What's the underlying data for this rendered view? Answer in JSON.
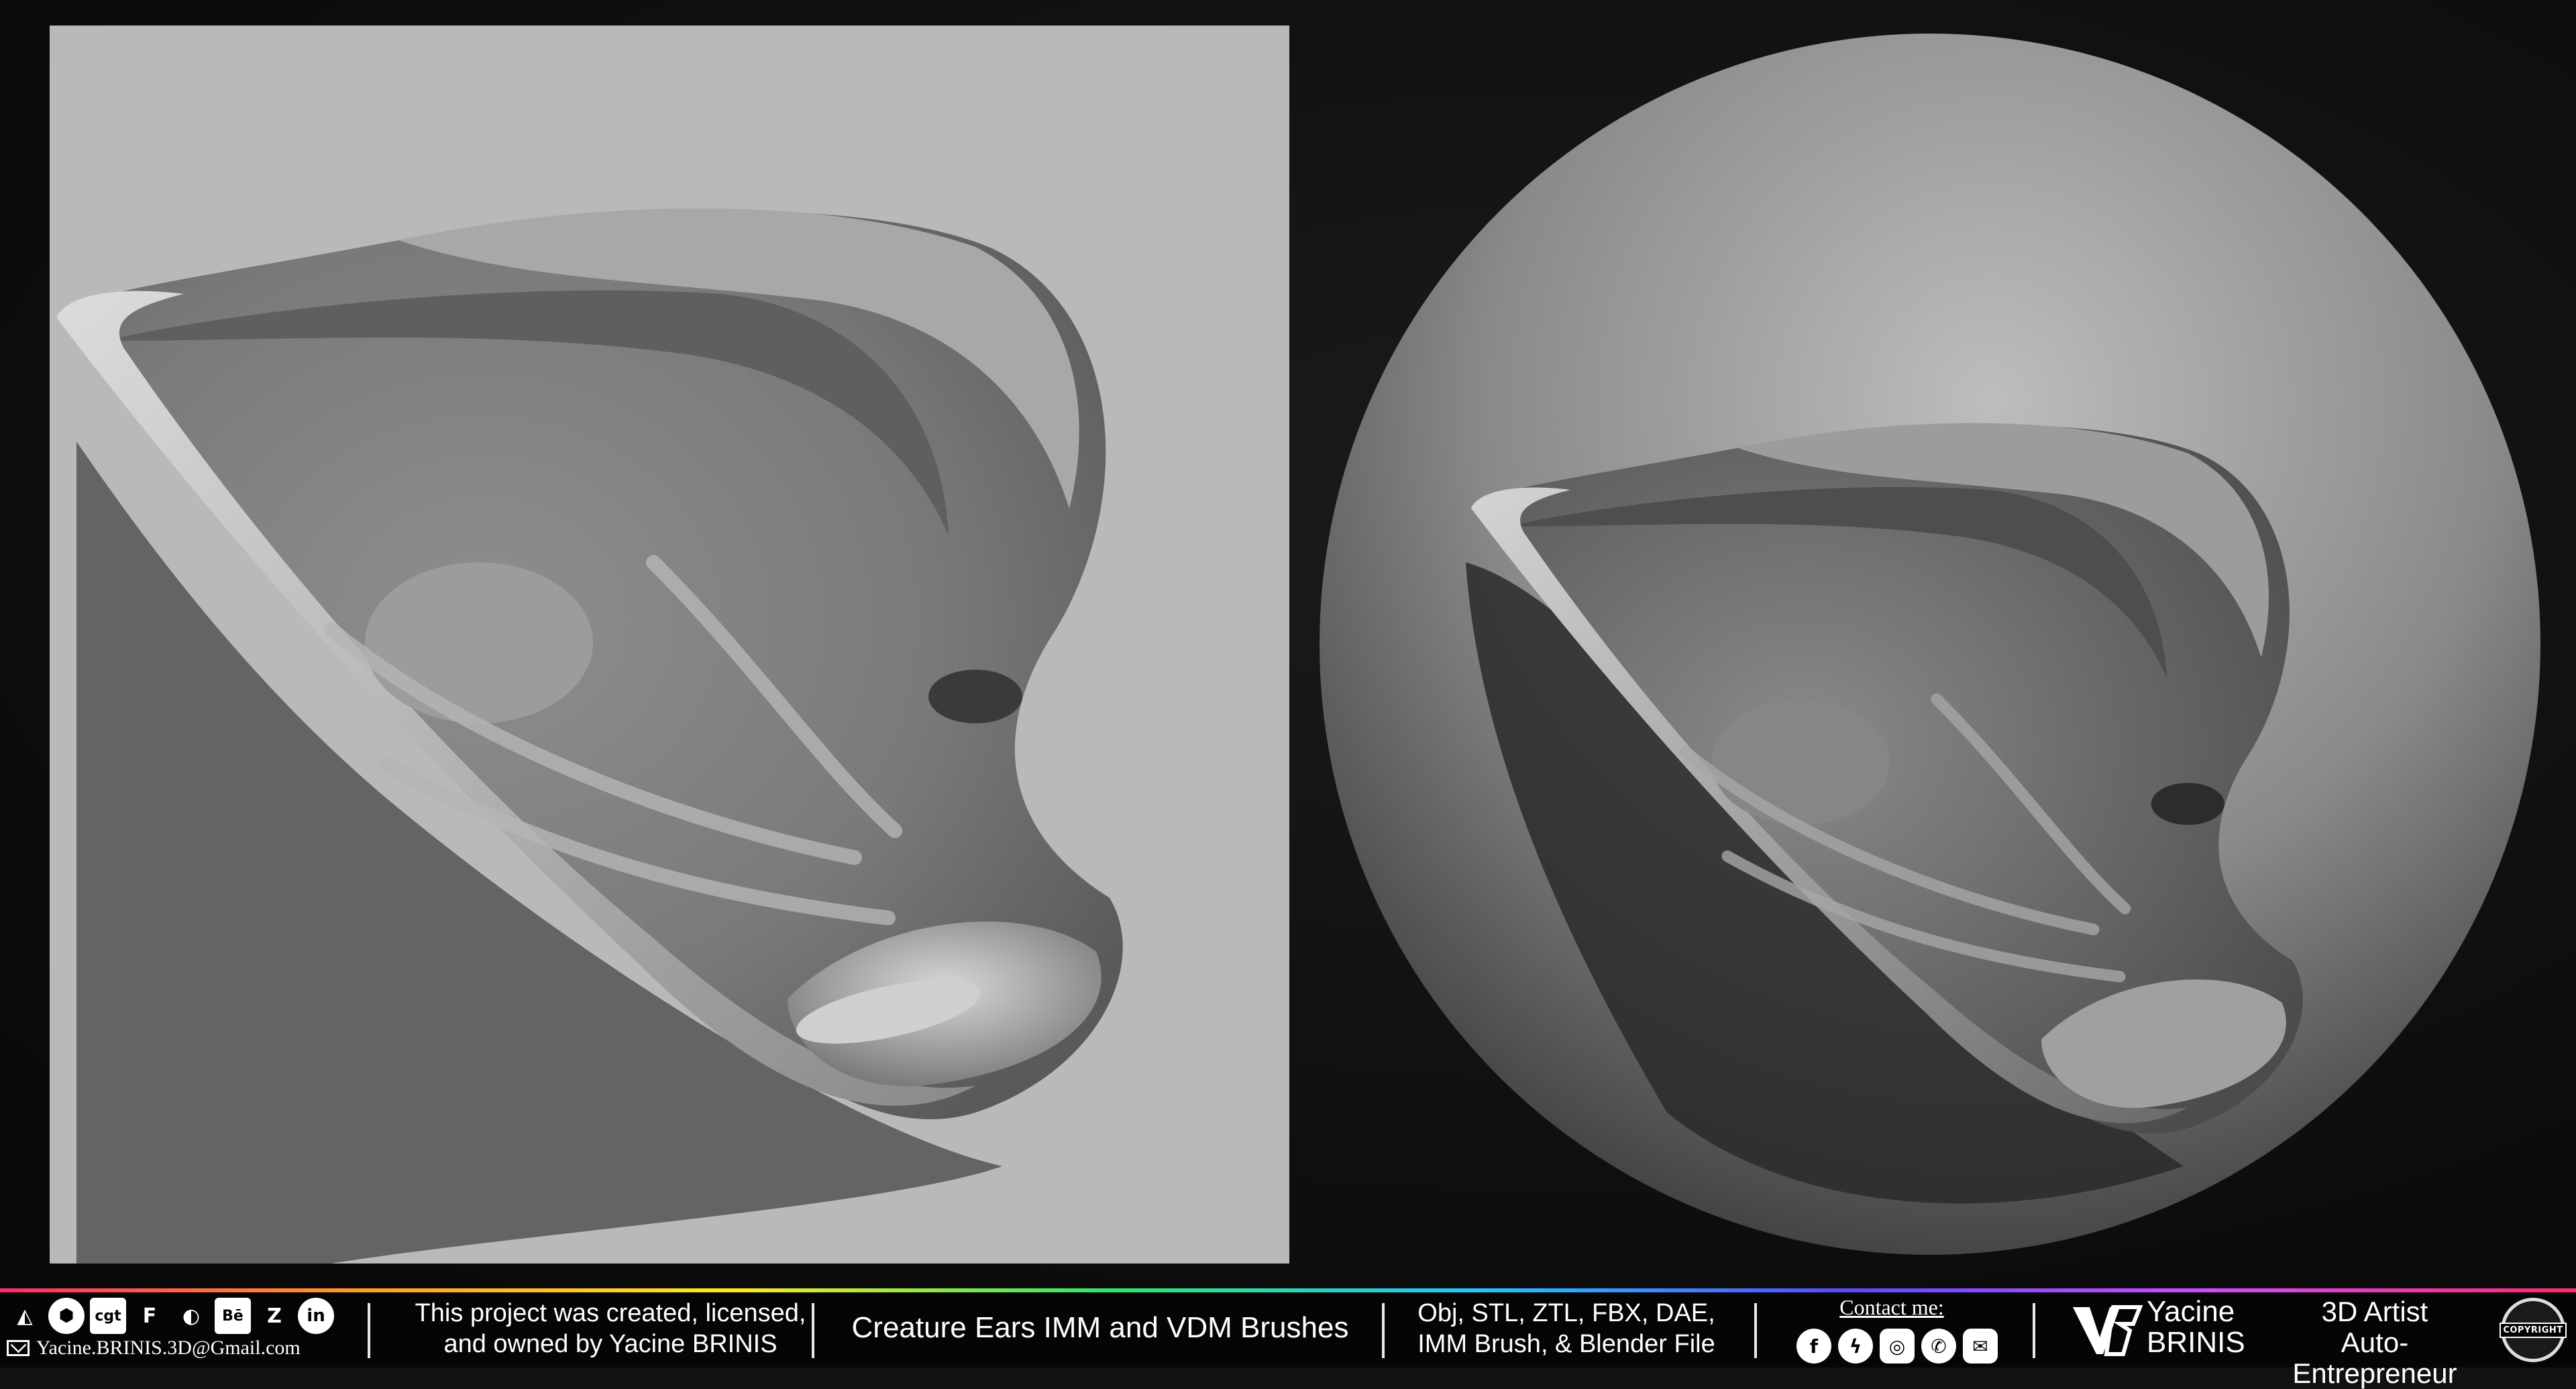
{
  "footer": {
    "social_icons": [
      {
        "icon": "artstation-icon",
        "glyph": "◭"
      },
      {
        "icon": "sketchfab-icon",
        "glyph": "⬢"
      },
      {
        "icon": "cgtrader-icon",
        "glyph": "cgt"
      },
      {
        "icon": "fab-icon",
        "glyph": "F"
      },
      {
        "icon": "cults-icon",
        "glyph": "◐"
      },
      {
        "icon": "behance-icon",
        "glyph": "Bē"
      },
      {
        "icon": "zbrush-icon",
        "glyph": "Z"
      },
      {
        "icon": "linkedin-icon",
        "glyph": "in"
      }
    ],
    "email": "Yacine.BRINIS.3D@Gmail.com",
    "license_line1": "This project was created, licensed,",
    "license_line2": "and owned by Yacine BRINIS",
    "project_title": "Creature Ears IMM and VDM Brushes",
    "formats_line1": "Obj, STL, ZTL, FBX, DAE,",
    "formats_line2": "IMM Brush, & Blender File",
    "contact_label": "Contact me:",
    "contact_icons": [
      {
        "icon": "facebook-icon",
        "glyph": "f"
      },
      {
        "icon": "messenger-icon",
        "glyph": "ϟ"
      },
      {
        "icon": "instagram-icon",
        "glyph": "◎"
      },
      {
        "icon": "whatsapp-icon",
        "glyph": "✆"
      },
      {
        "icon": "mail-icon",
        "glyph": "✉"
      }
    ],
    "author_first": "Yacine",
    "author_last": "BRINIS",
    "role_line1": "3D Artist",
    "role_line2": "Auto-Entrepreneur",
    "copyright_badge": "COPYRIGHT"
  },
  "colors": {
    "background": "#111111",
    "panel": "#b9b9b9",
    "sculpt": "#9a9a9a",
    "text": "#ffffff"
  }
}
